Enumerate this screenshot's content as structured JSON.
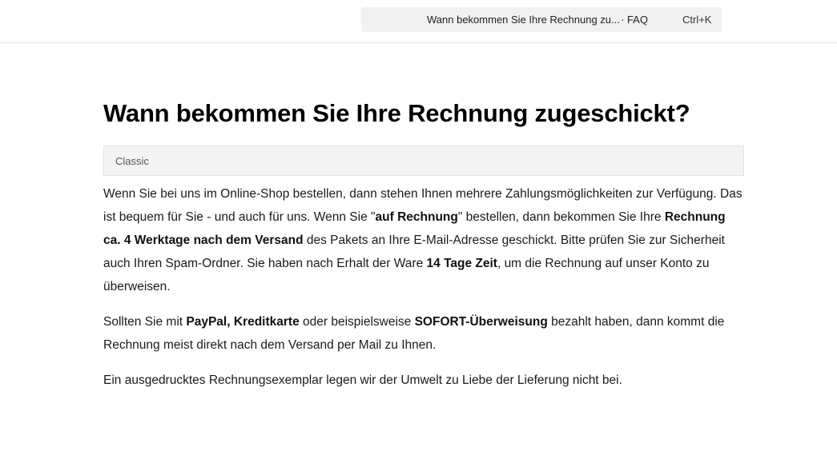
{
  "header": {
    "search": {
      "title": "Wann bekommen Sie Ihre Rechnung zu...",
      "section": "· FAQ",
      "shortcut": "Ctrl+K"
    }
  },
  "article": {
    "title": "Wann bekommen Sie Ihre Rechnung zugeschickt?",
    "tag": "Classic",
    "p1": {
      "t1": "Wenn Sie bei uns im Online-Shop bestellen, dann stehen Ihnen mehrere Zahlungsmöglichkeiten zur Verfügung. Das ist bequem für Sie - und auch für uns. Wenn Sie \"",
      "b1": "auf Rechnung",
      "t2": "\" bestellen, dann bekommen Sie Ihre ",
      "b2": "Rechnung ca. 4 Werktage nach dem Versand",
      "t3": " des Pakets an Ihre E-Mail-Adresse geschickt. Bitte prüfen Sie zur Sicherheit auch Ihren Spam-Ordner. Sie haben nach Erhalt der Ware ",
      "b3": "14 Tage Zeit",
      "t4": ", um die Rechnung auf unser Konto zu überweisen."
    },
    "p2": {
      "t1": "Sollten Sie mit ",
      "b1": "PayPal, Kreditkarte",
      "t2": " oder beispielsweise ",
      "b2": "SOFORT-Überweisung",
      "t3": " bezahlt haben, dann kommt die Rechnung meist direkt nach dem Versand per Mail zu Ihnen."
    },
    "p3": "Ein ausgedrucktes Rechnungsexemplar legen wir der Umwelt zu Liebe der Lieferung nicht bei."
  }
}
